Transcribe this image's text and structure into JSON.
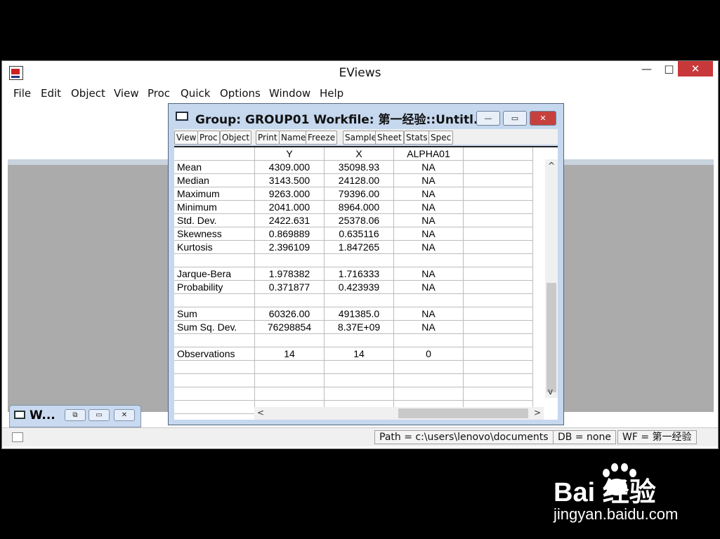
{
  "app": {
    "title": "EViews",
    "controls": {
      "minimize": "—",
      "maximize": "□",
      "close": "✕"
    }
  },
  "menu": [
    "File",
    "Edit",
    "Object",
    "View",
    "Proc",
    "Quick",
    "Options",
    "Window",
    "Help"
  ],
  "group_window": {
    "title": "Group: GROUP01   Workfile: 第一经验::Untitl...",
    "toolbar": [
      "View",
      "Proc",
      "Object",
      "Print",
      "Name",
      "Freeze",
      "Sample",
      "Sheet",
      "Stats",
      "Spec"
    ],
    "columns": [
      "",
      "Y",
      "X",
      "ALPHA01",
      ""
    ],
    "rows": [
      [
        "Mean",
        "4309.000",
        "35098.93",
        "NA"
      ],
      [
        "Median",
        "3143.500",
        "24128.00",
        "NA"
      ],
      [
        "Maximum",
        "9263.000",
        "79396.00",
        "NA"
      ],
      [
        "Minimum",
        "2041.000",
        "8964.000",
        "NA"
      ],
      [
        "Std. Dev.",
        "2422.631",
        "25378.06",
        "NA"
      ],
      [
        "Skewness",
        "0.869889",
        "0.635116",
        "NA"
      ],
      [
        "Kurtosis",
        "2.396109",
        "1.847265",
        "NA"
      ],
      [
        "",
        "",
        "",
        ""
      ],
      [
        "Jarque-Bera",
        "1.978382",
        "1.716333",
        "NA"
      ],
      [
        "Probability",
        "0.371877",
        "0.423939",
        "NA"
      ],
      [
        "",
        "",
        "",
        ""
      ],
      [
        "Sum",
        "60326.00",
        "491385.0",
        "NA"
      ],
      [
        "Sum Sq. Dev.",
        "76298854",
        "8.37E+09",
        "NA"
      ],
      [
        "",
        "",
        "",
        ""
      ],
      [
        "Observations",
        "14",
        "14",
        "0"
      ],
      [
        "",
        "",
        "",
        ""
      ],
      [
        "",
        "",
        "",
        ""
      ],
      [
        "",
        "",
        "",
        ""
      ],
      [
        "",
        "",
        "",
        ""
      ]
    ]
  },
  "minimized_window": {
    "title": "W..."
  },
  "status": {
    "path": "Path = c:\\users\\lenovo\\documents",
    "db": "DB = none",
    "wf": "WF = 第一经验"
  },
  "watermark": {
    "brand": "Bai  经验",
    "url": "jingyan.baidu.com"
  },
  "colors": {
    "close_red": "#c7383a",
    "workspace_gray": "#ababab",
    "window_frame": "#c6d8ee"
  }
}
